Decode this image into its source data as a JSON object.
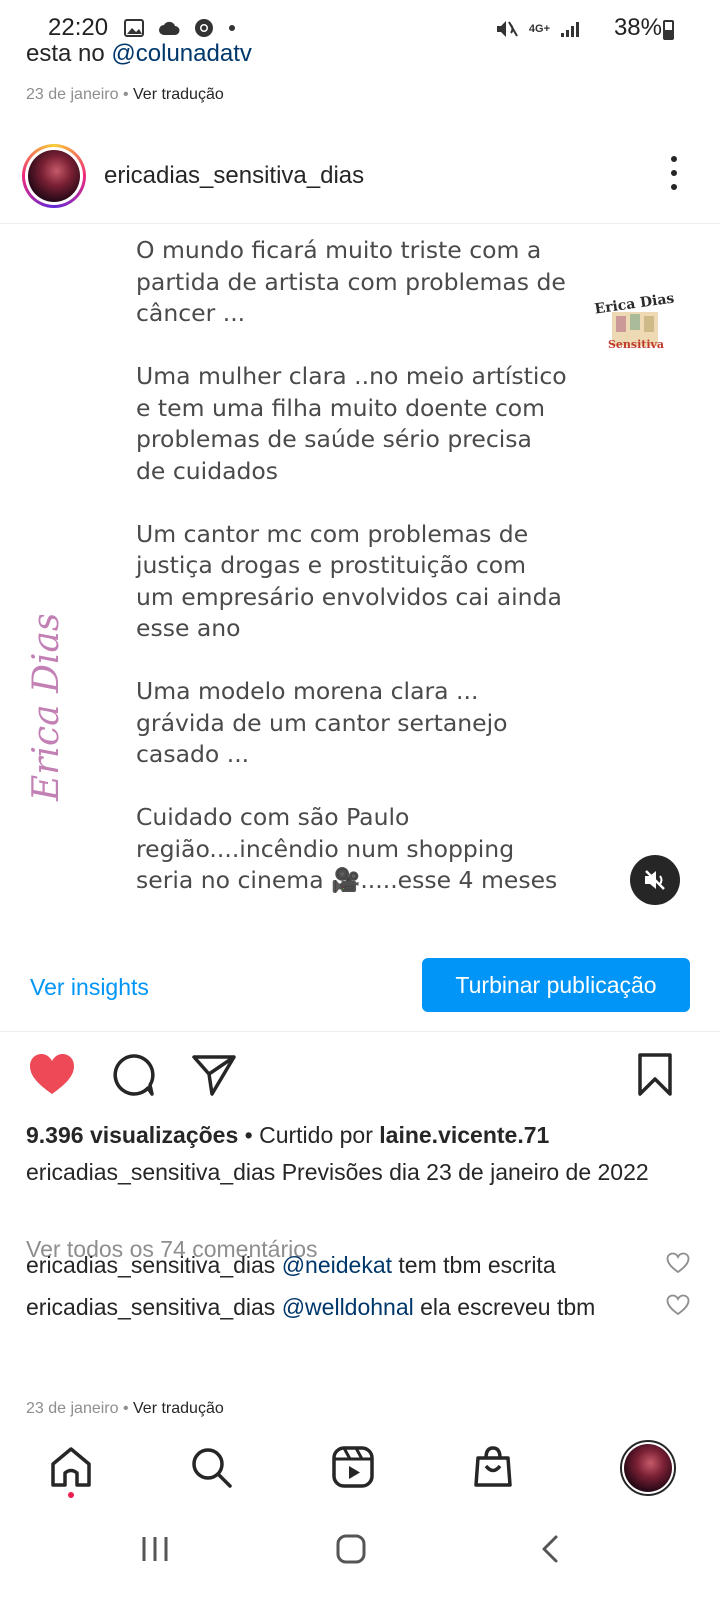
{
  "status_bar": {
    "time": "22:20",
    "battery": "38%",
    "network": "4G+"
  },
  "previous_post": {
    "caption_text": "esta no ",
    "caption_mention": "@colunadatv",
    "date": "23 de janeiro",
    "translate": "Ver tradução"
  },
  "post": {
    "username": "ericadias_sensitiva_dias",
    "image_text": "O mundo ficará muito triste com a\npartida de artista  com problemas de\ncâncer ...\n\nUma mulher clara ..no meio artístico\ne tem uma  filha muito doente com\nproblemas de saúde sério  precisa\nde cuidados\n\nUm cantor mc com problemas de\njustiça drogas e prostituição com\num empresário  envolvidos  cai ainda\nesse ano\n\nUma  modelo morena clara ...\ngrávida de um cantor sertanejo\ncasado   ...\n\nCuidado com são Paulo\nregião....incêndio num shopping\nseria no cinema 🎥.....esse 4 meses",
    "watermark_side": "Erica Dias Sensitiva",
    "watermark_logo_top": "Erica Dias",
    "watermark_logo_bottom": "Sensitiva",
    "insights_label": "Ver insights",
    "boost_label": "Turbinar publicação",
    "views": "9.396 visualizações",
    "liked_by_prefix": "• Curtido por ",
    "liked_by_user": "laine.vicente.71",
    "caption_user": "ericadias_sensitiva_dias",
    "caption_text": "Previsões dia 23 de janeiro de 2022",
    "view_all_comments": "Ver todos os 74 comentários",
    "comments": [
      {
        "user": "ericadias_sensitiva_dias",
        "mention": "@neidekat",
        "text": "tem tbm escrita"
      },
      {
        "user": "ericadias_sensitiva_dias",
        "mention": "@welldohnal",
        "text": "ela escreveu tbm"
      }
    ],
    "date": "23 de janeiro",
    "translate": "Ver tradução",
    "liked": true
  },
  "colors": {
    "accent": "#0095f6",
    "like": "#ed4956",
    "mention": "#00376b"
  },
  "nav": [
    "home-icon",
    "search-icon",
    "reels-icon",
    "shop-icon",
    "profile-avatar"
  ]
}
